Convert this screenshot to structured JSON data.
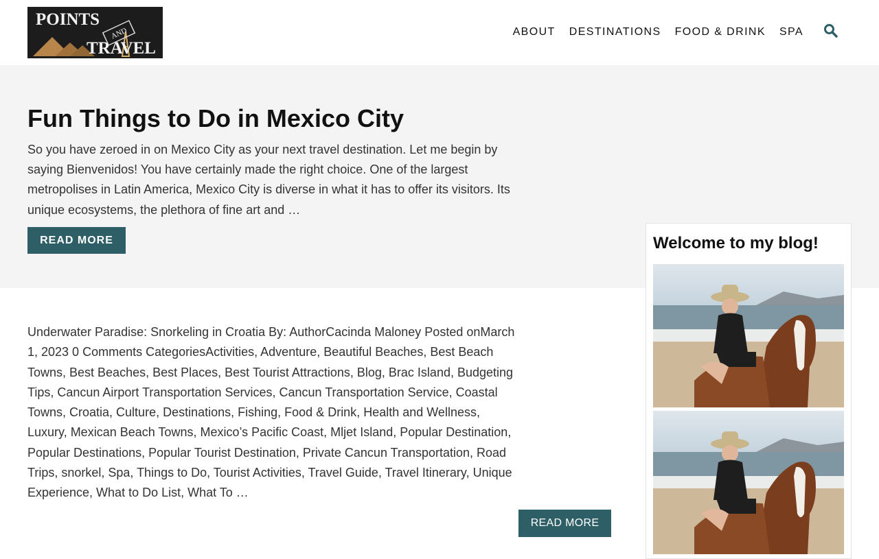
{
  "header": {
    "logo_text_top": "POINTS",
    "logo_text_mid": "AND",
    "logo_text_bottom": "TRAVEL",
    "nav": [
      "ABOUT",
      "DESTINATIONS",
      "FOOD & DRINK",
      "SPA"
    ],
    "search_icon": "search-icon"
  },
  "post1": {
    "title": "Fun Things to Do in Mexico City",
    "excerpt": "So you have zeroed in on Mexico City as your next travel destination. Let me begin by saying Bienvenidos! You have certainly made the right choice. One of the largest metropolises in Latin America, Mexico City is diverse in what it has to offer its visitors. Its unique ecosystems, the plethora of fine art and …",
    "button": "READ MORE"
  },
  "post2": {
    "text": "Underwater Paradise: Snorkeling in Croatia By: AuthorCacinda Maloney Posted onMarch 1, 2023  0 Comments CategoriesActivities, Adventure, Beautiful Beaches, Best Beach Towns, Best Beaches, Best Places, Best Tourist Attractions, Blog, Brac Island, Budgeting Tips, Cancun Airport Transportation Services, Cancun Transportation Service, Coastal Towns, Croatia, Culture, Destinations, Fishing, Food & Drink, Health and Wellness, Luxury, Mexican Beach Towns, Mexico’s Pacific Coast, Mljet Island, Popular Destination, Popular Destinations, Popular Tourist Destination, Private Cancun Transportation, Road Trips, snorkel, Spa, Things to Do, Tourist Activities, Travel Guide, Travel Itinerary, Unique Experience, What to Do List, What To …",
    "button": "READ MORE"
  },
  "sidebar": {
    "widget_title": "Welcome to my blog!"
  },
  "colors": {
    "accent": "#2e5f66",
    "band": "#f4f4f4",
    "logo_bg": "#1c1c1c",
    "logo_gold": "#c99b4a"
  }
}
